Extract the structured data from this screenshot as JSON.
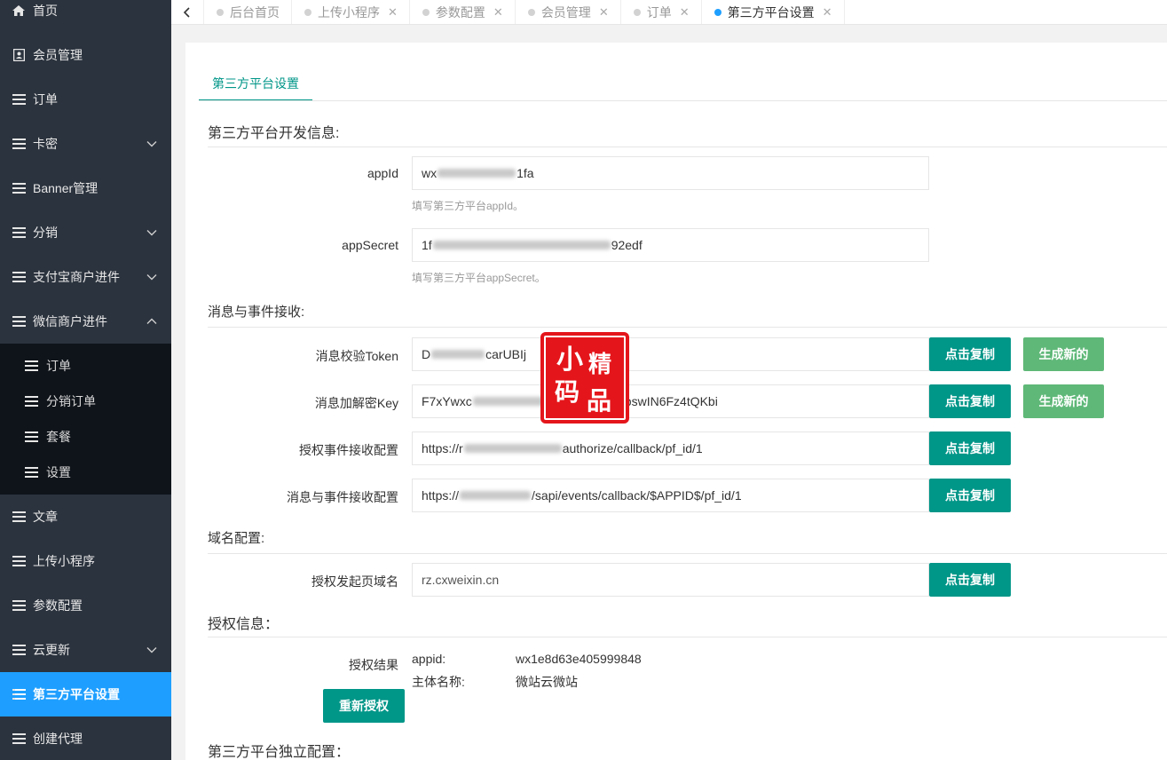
{
  "sidebar": {
    "items_top": [
      {
        "label": "首页",
        "icon": "home-icon",
        "has_chevron": false
      },
      {
        "label": "会员管理",
        "icon": "contact-card-icon",
        "has_chevron": false
      },
      {
        "label": "订单",
        "icon": "list-icon",
        "has_chevron": false
      },
      {
        "label": "卡密",
        "icon": "list-icon",
        "has_chevron": true
      },
      {
        "label": "Banner管理",
        "icon": "list-icon",
        "has_chevron": false
      },
      {
        "label": "分销",
        "icon": "list-icon",
        "has_chevron": true
      },
      {
        "label": "支付宝商户进件",
        "icon": "list-icon",
        "has_chevron": true
      },
      {
        "label": "微信商户进件",
        "icon": "list-icon",
        "has_chevron": true,
        "expanded": true
      }
    ],
    "sub_items": [
      {
        "label": "订单"
      },
      {
        "label": "分销订单"
      },
      {
        "label": "套餐"
      },
      {
        "label": "设置"
      }
    ],
    "items_bottom": [
      {
        "label": "文章"
      },
      {
        "label": "上传小程序"
      },
      {
        "label": "参数配置"
      },
      {
        "label": "云更新",
        "has_chevron": true
      },
      {
        "label": "第三方平台设置",
        "active": true
      },
      {
        "label": "创建代理"
      }
    ]
  },
  "tabs": [
    {
      "label": "后台首页",
      "closable": false,
      "active": false
    },
    {
      "label": "上传小程序",
      "closable": true,
      "active": false
    },
    {
      "label": "参数配置",
      "closable": true,
      "active": false
    },
    {
      "label": "会员管理",
      "closable": true,
      "active": false
    },
    {
      "label": "订单",
      "closable": true,
      "active": false
    },
    {
      "label": "第三方平台设置",
      "closable": true,
      "active": true
    }
  ],
  "page": {
    "inner_tab": "第三方平台设置",
    "section_dev": "第三方平台开发信息:",
    "appid_label": "appId",
    "appid_value_start": "wx",
    "appid_value_end": "1fa",
    "appid_hint": "填写第三方平台appId。",
    "appsecret_label": "appSecret",
    "appsecret_value_start": "1f",
    "appsecret_value_end": "92edf",
    "appsecret_hint": "填写第三方平台appSecret。",
    "section_msg": "消息与事件接收:",
    "token_label": "消息校验Token",
    "token_value_start": "D",
    "token_value_end": "carUBIj",
    "key_label": "消息加解密Key",
    "key_value_start": "F7xYwxc",
    "key_value_end": "pswIN6Fz4tQKbi",
    "auth_event_label": "授权事件接收配置",
    "auth_event_value_start": "https://r",
    "auth_event_value_end": "authorize/callback/pf_id/1",
    "msg_event_label": "消息与事件接收配置",
    "msg_event_value_start": "https://",
    "msg_event_value_end": "/sapi/events/callback/$APPID$/pf_id/1",
    "copy_label": "点击复制",
    "regen_label": "生成新的",
    "section_domain": "域名配置:",
    "domain_label": "授权发起页域名",
    "domain_value": "rz.cxweixin.cn",
    "section_auth": "授权信息：",
    "auth_result_label": "授权结果",
    "auth_appid_key": "appid:",
    "auth_appid_value": "wx1e8d63e405999848",
    "auth_subject_key": "主体名称:",
    "auth_subject_value": "微站云微站",
    "reauth_label": "重新授权",
    "section_independent": "第三方平台独立配置："
  },
  "watermark": {
    "chars": [
      "小",
      "精",
      "码",
      "品"
    ],
    "color": "#e4161b"
  },
  "colors": {
    "accent": "#009688",
    "green": "#5FB878",
    "blue": "#1E9FFF",
    "sidebar": "#2b333e"
  }
}
